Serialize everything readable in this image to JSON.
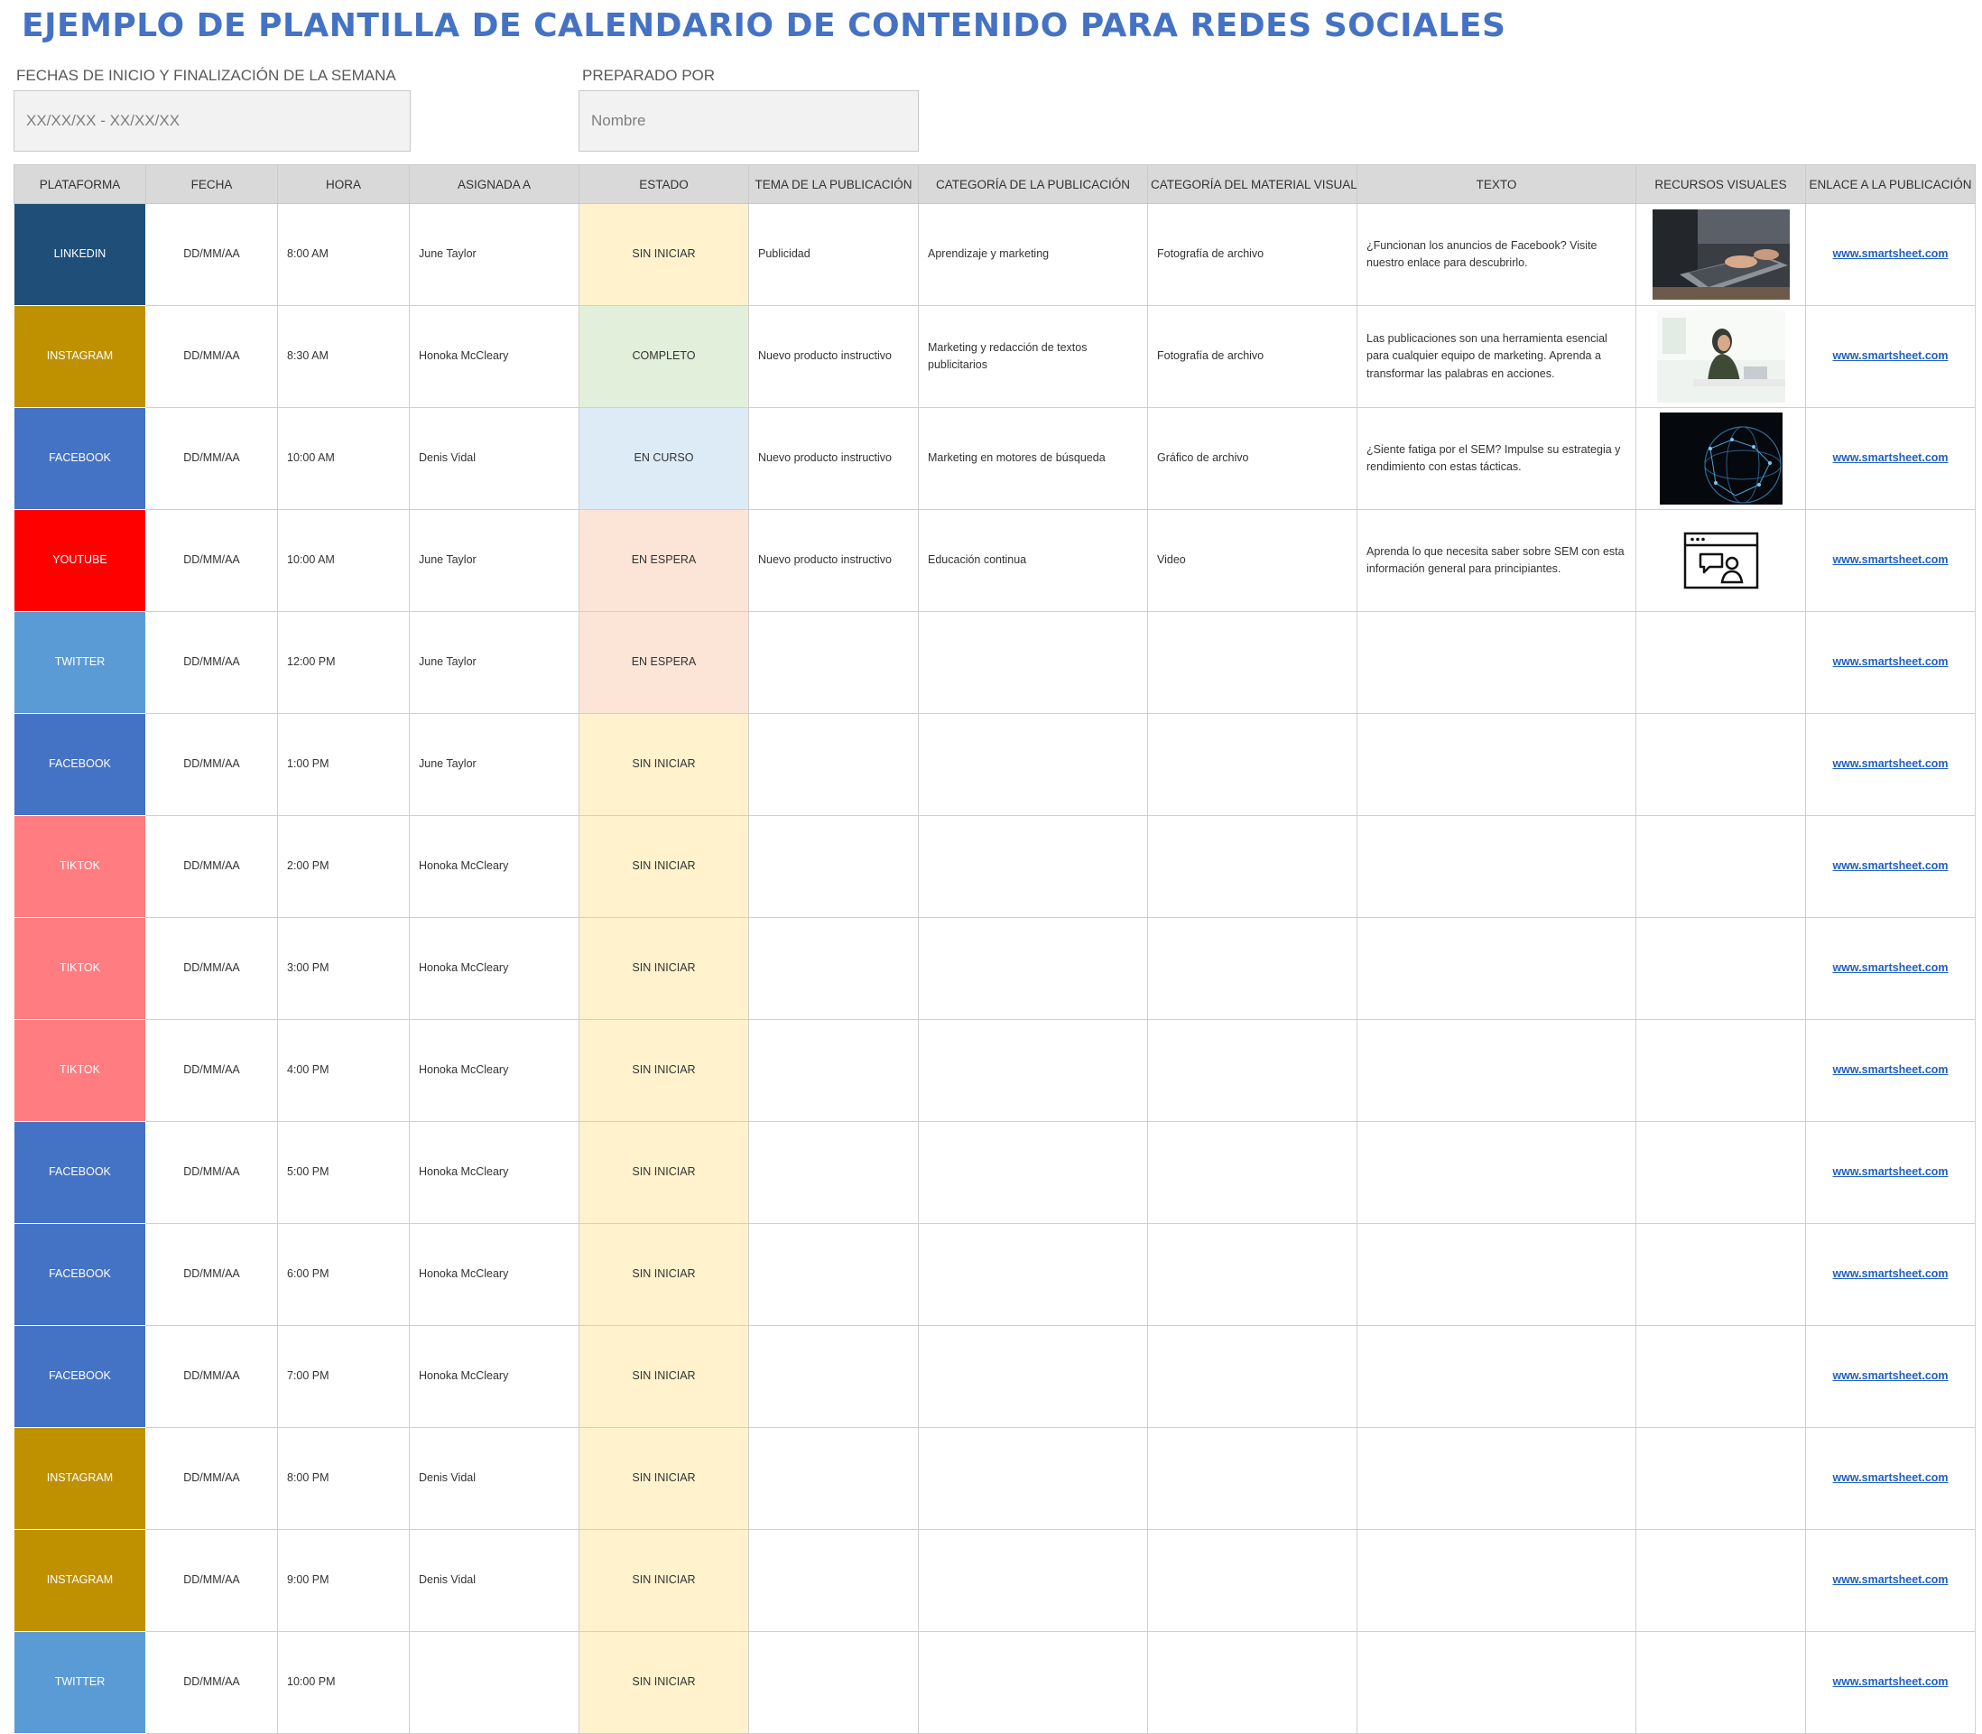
{
  "title": "EJEMPLO DE PLANTILLA DE CALENDARIO DE CONTENIDO PARA REDES SOCIALES",
  "week": {
    "label": "FECHAS DE INICIO Y FINALIZACIÓN DE LA SEMANA",
    "value": "XX/XX/XX - XX/XX/XX"
  },
  "prepared": {
    "label": "PREPARADO POR",
    "value": "Nombre"
  },
  "colors": {
    "LINKEDIN": "#1F4E79",
    "INSTAGRAM": "#BF9000",
    "FACEBOOK": "#4472C4",
    "YOUTUBE": "#FF0000",
    "TWITTER": "#5B9BD5",
    "TIKTOK": "#FF7C80",
    "SIN INICIAR": "#FFF2CC",
    "COMPLETO": "#E2EFDA",
    "EN CURSO": "#DDEBF7",
    "EN ESPERA": "#FCE4D6"
  },
  "table": {
    "headers": [
      "PLATAFORMA",
      "FECHA",
      "HORA",
      "ASIGNADA A",
      "ESTADO",
      "TEMA DE LA PUBLICACIÓN",
      "CATEGORÍA DE LA PUBLICACIÓN",
      "CATEGORÍA DEL MATERIAL VISUAL",
      "TEXTO",
      "RECURSOS VISUALES",
      "ENLACE A LA PUBLICACIÓN"
    ],
    "rows": [
      {
        "platform": "LINKEDIN",
        "date": "DD/MM/AA",
        "time": "8:00 AM",
        "assigned": "June Taylor",
        "status": "SIN INICIAR",
        "topic": "Publicidad",
        "category": "Aprendizaje y marketing",
        "visual_category": "Fotografía de archivo",
        "text": "¿Funcionan los anuncios de Facebook? Visite nuestro enlace para descubrirlo.",
        "resource": "laptop-photo",
        "link": "www.smartsheet.com"
      },
      {
        "platform": "INSTAGRAM",
        "date": "DD/MM/AA",
        "time": "8:30 AM",
        "assigned": "Honoka McCleary",
        "status": "COMPLETO",
        "topic": "Nuevo producto instructivo",
        "category": "Marketing y redacción de textos publicitarios",
        "visual_category": "Fotografía de archivo",
        "text": "Las publicaciones son una herramienta esencial para cualquier equipo de marketing. Aprenda a transformar las palabras en acciones.",
        "resource": "office-woman-photo",
        "link": "www.smartsheet.com"
      },
      {
        "platform": "FACEBOOK",
        "date": "DD/MM/AA",
        "time": "10:00 AM",
        "assigned": "Denis Vidal",
        "status": "EN CURSO",
        "topic": "Nuevo producto instructivo",
        "category": "Marketing en motores de búsqueda",
        "visual_category": "Gráfico de archivo",
        "text": "¿Siente fatiga por el SEM? Impulse su estrategia y rendimiento con estas tácticas.",
        "resource": "network-globe-graphic",
        "link": "www.smartsheet.com"
      },
      {
        "platform": "YOUTUBE",
        "date": "DD/MM/AA",
        "time": "10:00 AM",
        "assigned": "June Taylor",
        "status": "EN ESPERA",
        "topic": "Nuevo producto instructivo",
        "category": "Educación continua",
        "visual_category": "Video",
        "text": "Aprenda lo que necesita saber sobre SEM con esta información general para principiantes.",
        "resource": "video-chat-icon",
        "link": "www.smartsheet.com"
      },
      {
        "platform": "TWITTER",
        "date": "DD/MM/AA",
        "time": "12:00 PM",
        "assigned": "June Taylor",
        "status": "EN ESPERA",
        "topic": "",
        "category": "",
        "visual_category": "",
        "text": "",
        "resource": "",
        "link": "www.smartsheet.com"
      },
      {
        "platform": "FACEBOOK",
        "date": "DD/MM/AA",
        "time": "1:00 PM",
        "assigned": "June Taylor",
        "status": "SIN INICIAR",
        "topic": "",
        "category": "",
        "visual_category": "",
        "text": "",
        "resource": "",
        "link": "www.smartsheet.com"
      },
      {
        "platform": "TIKTOK",
        "date": "DD/MM/AA",
        "time": "2:00 PM",
        "assigned": "Honoka McCleary",
        "status": "SIN INICIAR",
        "topic": "",
        "category": "",
        "visual_category": "",
        "text": "",
        "resource": "",
        "link": "www.smartsheet.com"
      },
      {
        "platform": "TIKTOK",
        "date": "DD/MM/AA",
        "time": "3:00 PM",
        "assigned": "Honoka McCleary",
        "status": "SIN INICIAR",
        "topic": "",
        "category": "",
        "visual_category": "",
        "text": "",
        "resource": "",
        "link": "www.smartsheet.com"
      },
      {
        "platform": "TIKTOK",
        "date": "DD/MM/AA",
        "time": "4:00 PM",
        "assigned": "Honoka McCleary",
        "status": "SIN INICIAR",
        "topic": "",
        "category": "",
        "visual_category": "",
        "text": "",
        "resource": "",
        "link": "www.smartsheet.com"
      },
      {
        "platform": "FACEBOOK",
        "date": "DD/MM/AA",
        "time": "5:00 PM",
        "assigned": "Honoka McCleary",
        "status": "SIN INICIAR",
        "topic": "",
        "category": "",
        "visual_category": "",
        "text": "",
        "resource": "",
        "link": "www.smartsheet.com"
      },
      {
        "platform": "FACEBOOK",
        "date": "DD/MM/AA",
        "time": "6:00 PM",
        "assigned": "Honoka McCleary",
        "status": "SIN INICIAR",
        "topic": "",
        "category": "",
        "visual_category": "",
        "text": "",
        "resource": "",
        "link": "www.smartsheet.com"
      },
      {
        "platform": "FACEBOOK",
        "date": "DD/MM/AA",
        "time": "7:00 PM",
        "assigned": "Honoka McCleary",
        "status": "SIN INICIAR",
        "topic": "",
        "category": "",
        "visual_category": "",
        "text": "",
        "resource": "",
        "link": "www.smartsheet.com"
      },
      {
        "platform": "INSTAGRAM",
        "date": "DD/MM/AA",
        "time": "8:00 PM",
        "assigned": "Denis Vidal",
        "status": "SIN INICIAR",
        "topic": "",
        "category": "",
        "visual_category": "",
        "text": "",
        "resource": "",
        "link": "www.smartsheet.com"
      },
      {
        "platform": "INSTAGRAM",
        "date": "DD/MM/AA",
        "time": "9:00 PM",
        "assigned": "Denis Vidal",
        "status": "SIN INICIAR",
        "topic": "",
        "category": "",
        "visual_category": "",
        "text": "",
        "resource": "",
        "link": "www.smartsheet.com"
      },
      {
        "platform": "TWITTER",
        "date": "DD/MM/AA",
        "time": "10:00 PM",
        "assigned": "",
        "status": "SIN INICIAR",
        "topic": "",
        "category": "",
        "visual_category": "",
        "text": "",
        "resource": "",
        "link": "www.smartsheet.com"
      }
    ]
  }
}
